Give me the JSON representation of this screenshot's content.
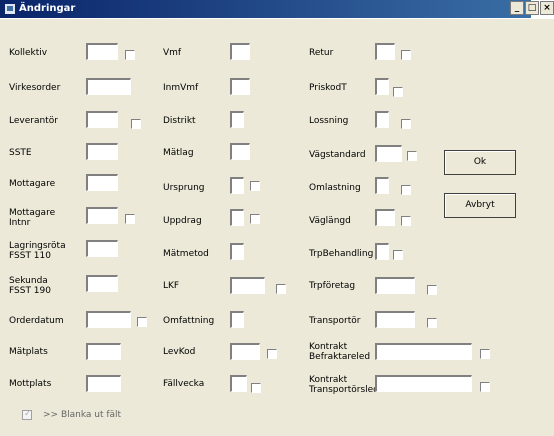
{
  "window": {
    "title": "Ändringar",
    "controls": {
      "minimize": "_",
      "maximize": "□",
      "close": "×"
    }
  },
  "fields_col1": [
    {
      "label": "Kollektiv",
      "value": ""
    },
    {
      "label": "Virkesorder",
      "value": ""
    },
    {
      "label": "Leverantör",
      "value": ""
    },
    {
      "label": "SSTE",
      "value": ""
    },
    {
      "label": "Mottagare",
      "value": ""
    },
    {
      "label": "Mottagare\nIntnr",
      "value": ""
    },
    {
      "label": "Lagringsröta\nFSST 110",
      "value": ""
    },
    {
      "label": "Sekunda\nFSST 190",
      "value": ""
    },
    {
      "label": "Orderdatum",
      "value": ""
    },
    {
      "label": "Mätplats",
      "value": ""
    },
    {
      "label": "Mottplats",
      "value": ""
    }
  ],
  "fields_col2": [
    {
      "label": "Vmf",
      "value": ""
    },
    {
      "label": "InmVmf",
      "value": ""
    },
    {
      "label": "Distrikt",
      "value": ""
    },
    {
      "label": "Mätlag",
      "value": ""
    },
    {
      "label": "Ursprung",
      "value": ""
    },
    {
      "label": "Uppdrag",
      "value": ""
    },
    {
      "label": "Mätmetod",
      "value": ""
    },
    {
      "label": "LKF",
      "value": ""
    },
    {
      "label": "Omfattning",
      "value": ""
    },
    {
      "label": "LevKod",
      "value": ""
    },
    {
      "label": "Fällvecka",
      "value": ""
    }
  ],
  "fields_col3": [
    {
      "label": "Retur",
      "value": ""
    },
    {
      "label": "PriskodT",
      "value": ""
    },
    {
      "label": "Lossning",
      "value": ""
    },
    {
      "label": "Vägstandard",
      "value": ""
    },
    {
      "label": "Omlastning",
      "value": ""
    },
    {
      "label": "Väglängd",
      "value": ""
    },
    {
      "label": "TrpBehandling",
      "value": ""
    },
    {
      "label": "Trpföretag",
      "value": ""
    },
    {
      "label": "Transportör",
      "value": ""
    },
    {
      "label": "Kontrakt\nBefraktareled",
      "value": ""
    },
    {
      "label": "Kontrakt\nTransportörsled",
      "value": ""
    }
  ],
  "buttons": {
    "ok": "Ok",
    "cancel": "Avbryt"
  },
  "bottom": {
    "clear_label": ">> Blanka ut fält",
    "clear_checked": true
  }
}
